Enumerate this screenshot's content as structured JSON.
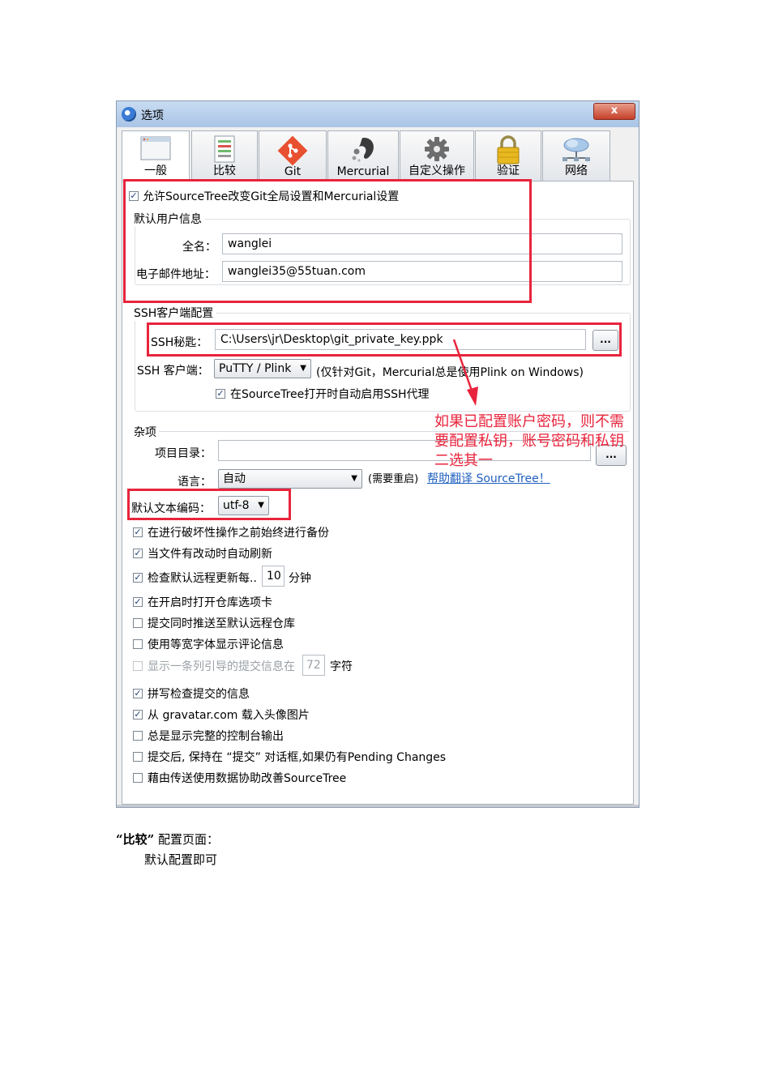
{
  "window": {
    "title": "选项",
    "close_label": "x"
  },
  "tabs": [
    {
      "label": "一般",
      "icon": "window-icon"
    },
    {
      "label": "比较",
      "icon": "compare-icon"
    },
    {
      "label": "Git",
      "icon": "git-icon"
    },
    {
      "label": "Mercurial",
      "icon": "mercurial-icon"
    },
    {
      "label": "自定义操作",
      "icon": "gear-icon"
    },
    {
      "label": "验证",
      "icon": "lock-icon"
    },
    {
      "label": "网络",
      "icon": "network-icon"
    }
  ],
  "general": {
    "allow_global_label": "允许SourceTree改变Git全局设置和Mercurial设置",
    "allow_global_checked": true,
    "user_info_group": "默认用户信息",
    "fullname_label": "全名：",
    "fullname_value": "wanglei",
    "email_label": "电子邮件地址：",
    "email_value": "wanglei35@55tuan.com"
  },
  "ssh": {
    "group": "SSH客户端配置",
    "key_label": "SSH秘匙：",
    "key_value": "C:\\Users\\jr\\Desktop\\git_private_key.ppk",
    "browse_label": "...",
    "client_label": "SSH 客户端：",
    "client_value": "PuTTY / Plink",
    "client_note": "(仅针对Git，Mercurial总是使用Plink on Windows)",
    "agent_label": "在SourceTree打开时自动启用SSH代理",
    "agent_checked": true
  },
  "annotation": {
    "lines": [
      "如果已配置账户密码，则不需",
      "要配置私钥，账号密码和私钥",
      "二选其一"
    ],
    "color": "#e8243c"
  },
  "misc": {
    "group": "杂项",
    "project_dir_label": "项目目录：",
    "project_dir_value": "",
    "browse_label": "...",
    "language_label": "语言：",
    "language_value": "自动",
    "restart_note": "(需要重启)",
    "translate_link": "帮助翻译 SourceTree！",
    "encoding_label": "默认文本编码：",
    "encoding_value": "utf-8",
    "options": [
      {
        "label": "在进行破坏性操作之前始终进行备份",
        "checked": true
      },
      {
        "label": "当文件有改动时自动刷新",
        "checked": true
      },
      {
        "label": "检查默认远程更新每..",
        "checked": true,
        "value": "10",
        "suffix": "分钟"
      },
      {
        "label": "在开启时打开仓库选项卡",
        "checked": true
      },
      {
        "label": "提交同时推送至默认远程仓库",
        "checked": false
      },
      {
        "label": "使用等宽字体显示评论信息",
        "checked": false
      },
      {
        "label": "显示一条列引导的提交信息在",
        "checked": false,
        "disabled": true,
        "value": "72",
        "suffix": "字符"
      },
      {
        "label": "拼写检查提交的信息",
        "checked": true
      },
      {
        "label": "从 gravatar.com 载入头像图片",
        "checked": true
      },
      {
        "label": "总是显示完整的控制台输出",
        "checked": false
      },
      {
        "label": "提交后, 保持在 “提交” 对话框,如果仍有Pending Changes",
        "checked": false
      },
      {
        "label": "藉由传送使用数据协助改善SourceTree",
        "checked": false
      }
    ]
  },
  "doc": {
    "caption_quote": "“比较”",
    "caption_rest": " 配置页面：",
    "note": "默认配置即可"
  }
}
